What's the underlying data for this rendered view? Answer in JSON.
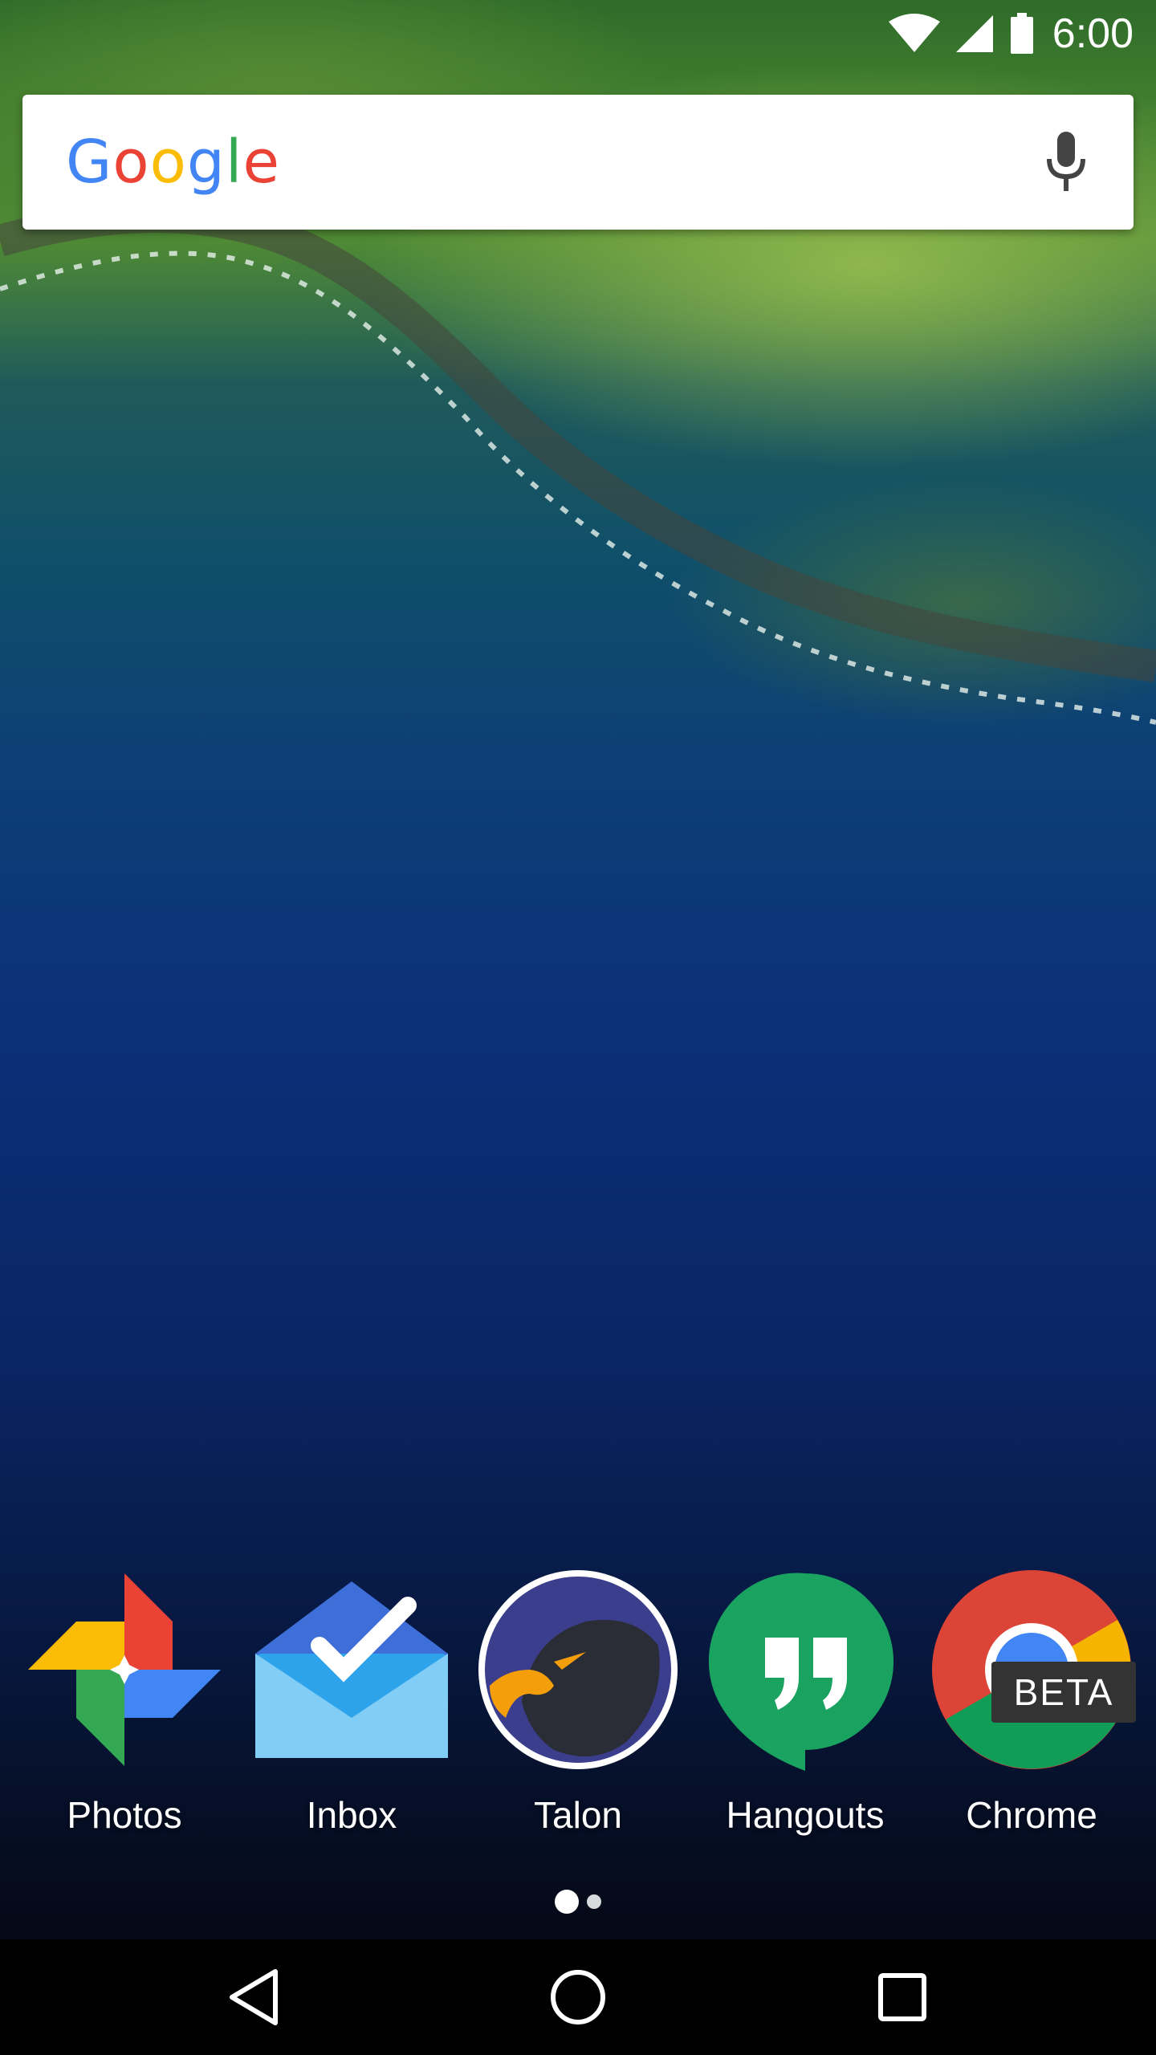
{
  "status_bar": {
    "time": "6:00",
    "icons": [
      "wifi-icon",
      "cell-signal-icon",
      "battery-icon"
    ]
  },
  "search": {
    "logo_text": "Google",
    "logo_colors": [
      "#4285F4",
      "#EA4335",
      "#FBBC05",
      "#4285F4",
      "#34A853",
      "#EA4335"
    ],
    "mic_icon": "mic-icon"
  },
  "dock": {
    "apps": [
      {
        "label": "Photos",
        "icon": "photos-icon"
      },
      {
        "label": "Inbox",
        "icon": "inbox-icon"
      },
      {
        "label": "Talon",
        "icon": "talon-icon"
      },
      {
        "label": "Hangouts",
        "icon": "hangouts-icon"
      },
      {
        "label": "Chrome",
        "icon": "chrome-beta-icon",
        "badge": "BETA"
      }
    ]
  },
  "page_indicator": {
    "pages": 2,
    "current": 1
  },
  "nav_bar": {
    "buttons": [
      "back-icon",
      "home-icon",
      "recents-icon"
    ]
  },
  "colors": {
    "google_blue": "#4285F4",
    "google_red": "#EA4335",
    "google_yellow": "#FBBC05",
    "google_green": "#34A853",
    "hangouts_green": "#1AA261",
    "talon_navy": "#34366B"
  }
}
